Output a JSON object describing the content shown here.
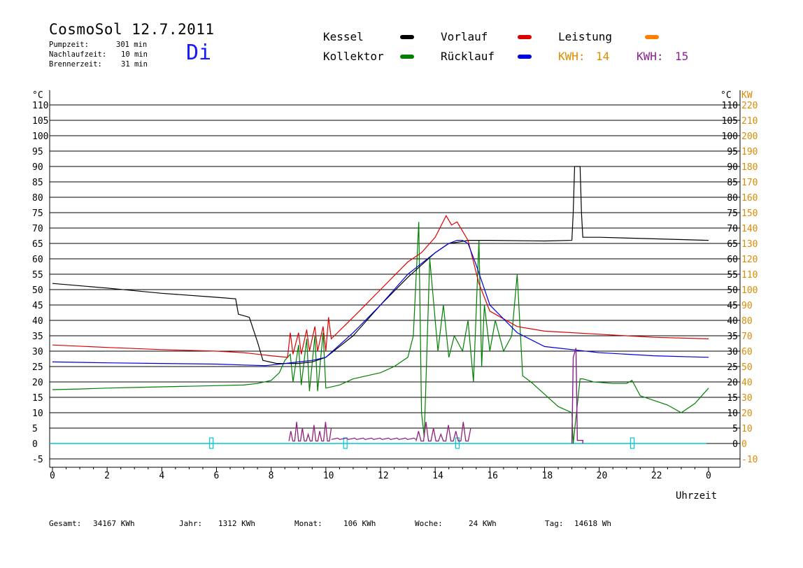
{
  "header": {
    "title": "CosmoSol 12.7.2011",
    "day": "Di",
    "stats": [
      {
        "label": "Pumpzeit:",
        "value": "301 min"
      },
      {
        "label": "Nachlaufzeit:",
        "value": "10 min"
      },
      {
        "label": "Brennerzeit:",
        "value": "31 min"
      }
    ]
  },
  "legend": {
    "items": [
      {
        "label": "Kessel",
        "color": "#000000"
      },
      {
        "label": "Vorlauf",
        "color": "#dd0000"
      },
      {
        "label": "Leistung",
        "color": "#ff8000"
      },
      {
        "label": "Kollektor",
        "color": "#008000"
      },
      {
        "label": "Rücklauf",
        "color": "#0000dd"
      }
    ],
    "kwh": [
      {
        "label": "KWH:",
        "value": "14",
        "color": "#e08a00"
      },
      {
        "label": "KWH:",
        "value": "15",
        "color": "#8a2090"
      }
    ]
  },
  "axes": {
    "left_unit": "°C",
    "right_unit": "°C",
    "right_unit2": "KW",
    "x_title": "Uhrzeit"
  },
  "footer": [
    {
      "label": "Gesamt:",
      "value": "34167 KWh"
    },
    {
      "label": "Jahr:",
      "value": "1312 KWh"
    },
    {
      "label": "Monat:",
      "value": "106 KWh"
    },
    {
      "label": "Woche:",
      "value": "24 KWh"
    },
    {
      "label": "Tag:",
      "value": "14618 Wh"
    }
  ],
  "chart_data": {
    "type": "line",
    "xlim": [
      0,
      24
    ],
    "ylim": [
      -5,
      110
    ],
    "y2lim": [
      -10,
      220
    ],
    "x_ticks": [
      "0",
      "2",
      "4",
      "6",
      "8",
      "10",
      "12",
      "14",
      "16",
      "18",
      "20",
      "22",
      "0"
    ],
    "y_ticks": [
      -5,
      0,
      5,
      10,
      15,
      20,
      25,
      30,
      35,
      40,
      45,
      50,
      55,
      60,
      65,
      70,
      75,
      80,
      85,
      90,
      95,
      100,
      105,
      110
    ],
    "y2_ticks": [
      -10,
      0,
      10,
      20,
      30,
      40,
      50,
      60,
      70,
      80,
      90,
      100,
      110,
      120,
      130,
      140,
      150,
      160,
      170,
      180,
      190,
      200,
      210,
      220
    ],
    "xlabel": "Uhrzeit",
    "ylabel": "°C",
    "y2label": "KW",
    "grid": true,
    "series": [
      {
        "name": "Kessel",
        "color": "#000000",
        "x": [
          0,
          2,
          4,
          6,
          6.7,
          6.8,
          7.2,
          7.5,
          7.6,
          7.7,
          8.2,
          9.0,
          9.5,
          10,
          11,
          12,
          13,
          14,
          14.5,
          14.9,
          15.2,
          16,
          18,
          19.0,
          19.05,
          19.1,
          19.3,
          19.35,
          19.4,
          20,
          22,
          24
        ],
        "y": [
          52,
          50.5,
          48.8,
          47.5,
          47,
          42,
          41,
          33,
          30,
          27,
          26,
          26,
          26.5,
          28,
          35,
          45,
          54,
          62,
          65,
          65.5,
          66,
          66,
          65.8,
          66,
          75,
          90,
          90,
          75,
          67,
          67,
          66.5,
          66
        ]
      },
      {
        "name": "Vorlauf",
        "color": "#dd0000",
        "x": [
          0,
          2,
          4,
          6,
          7,
          8,
          8.6,
          8.7,
          8.8,
          9.0,
          9.1,
          9.3,
          9.4,
          9.6,
          9.7,
          9.9,
          10.0,
          10.1,
          10.2,
          11,
          12,
          13,
          13.5,
          14,
          14.4,
          14.6,
          14.8,
          15.0,
          15.2,
          15.6,
          16,
          17,
          18,
          20,
          22,
          24
        ],
        "y": [
          32,
          31.2,
          30.5,
          30,
          29.5,
          28.5,
          28,
          36,
          29,
          36,
          29,
          37,
          30,
          38,
          30,
          38,
          30,
          41,
          34,
          41,
          50,
          59,
          62,
          67,
          74,
          71,
          72,
          69,
          66,
          52,
          43,
          38,
          36.5,
          35.5,
          34.5,
          34
        ]
      },
      {
        "name": "Rücklauf",
        "color": "#0000dd",
        "x": [
          0,
          2,
          4,
          6,
          7,
          7.8,
          8.0,
          8.5,
          9.0,
          9.5,
          10,
          11,
          12,
          13,
          14,
          14.5,
          14.8,
          15.0,
          15.2,
          15.5,
          16,
          17,
          18,
          20,
          22,
          24
        ],
        "y": [
          26.5,
          26.2,
          26,
          25.8,
          25.5,
          25.3,
          25.5,
          26,
          26.5,
          27,
          28,
          36,
          45,
          55,
          62,
          65,
          66,
          66,
          65,
          58,
          45,
          36,
          31.5,
          29.5,
          28.5,
          28
        ]
      },
      {
        "name": "Kollektor",
        "color": "#008000",
        "x": [
          0,
          1,
          2,
          3,
          4,
          5,
          6,
          7,
          7.5,
          8,
          8.3,
          8.5,
          8.7,
          8.8,
          9.0,
          9.1,
          9.3,
          9.4,
          9.6,
          9.7,
          9.9,
          10.0,
          10.5,
          11,
          11.5,
          12,
          12.5,
          13,
          13.2,
          13.4,
          13.5,
          13.6,
          13.8,
          14.0,
          14.1,
          14.3,
          14.5,
          14.7,
          15.0,
          15.2,
          15.4,
          15.6,
          15.7,
          15.8,
          16.0,
          16.2,
          16.5,
          16.8,
          17.0,
          17.2,
          17.5,
          18,
          18.5,
          19,
          19.05,
          19.3,
          19.4,
          19.8,
          20.5,
          21.0,
          21.2,
          21.5,
          22,
          22.5,
          23,
          23.5,
          24
        ],
        "y": [
          17.5,
          17.7,
          18,
          18.2,
          18.4,
          18.6,
          18.8,
          19,
          19.5,
          20.5,
          23,
          27,
          29,
          20,
          32,
          19,
          34,
          17,
          35,
          17,
          36,
          18,
          19,
          21,
          22,
          23,
          25,
          28,
          35,
          72,
          10,
          2,
          60,
          40,
          30,
          45,
          28,
          35,
          30,
          40,
          20,
          66,
          25,
          45,
          30,
          40,
          30,
          35,
          55,
          22,
          20,
          16,
          12,
          10,
          0,
          21,
          21,
          20,
          19.5,
          19.5,
          20.5,
          15.5,
          14,
          12.5,
          10,
          13,
          18
        ]
      }
    ]
  }
}
